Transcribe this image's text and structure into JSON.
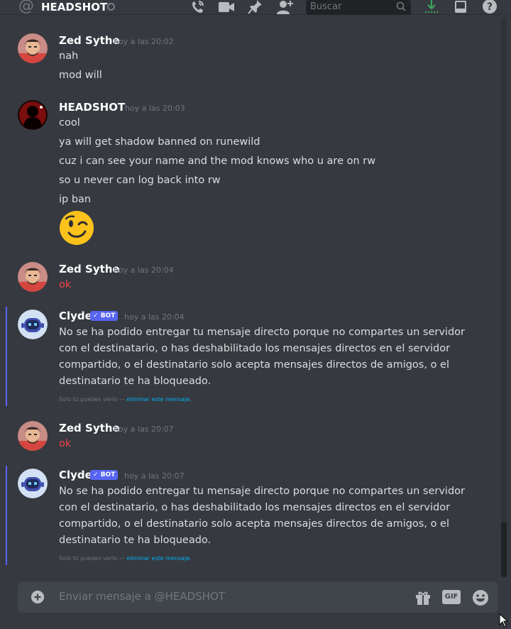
{
  "header": {
    "channel_title": "HEADSHOT",
    "search_placeholder": "Buscar"
  },
  "messages": [
    {
      "author": "Zed Sythe",
      "timestamp": "hoy a las 20:02",
      "lines": [
        "nah",
        "mod will"
      ]
    },
    {
      "author": "HEADSHOT",
      "timestamp": "hoy a las 20:03",
      "lines": [
        "cool",
        "ya will get shadow banned on runewild",
        "cuz i can see your name and the mod knows who u are on rw",
        "so u never can log back into rw",
        "ip ban"
      ],
      "emoji": "winking-face"
    },
    {
      "author": "Zed Sythe",
      "timestamp": "hoy a las 20:04",
      "lines": [
        "ok"
      ]
    },
    {
      "author": "Clyde",
      "badge": "BOT",
      "timestamp": "hoy a las 20:04",
      "body": "No se ha podido entregar tu mensaje directo porque no compartes un servidor con el destinatario, o has deshabilitado los mensajes directos en el servidor compartido, o el destinatario solo acepta mensajes directos de amigos, o el destinatario te ha bloqueado.",
      "ephemeral_text": "Solo tú puedes verlo —",
      "ephemeral_link": "eliminar este mensaje."
    },
    {
      "author": "Zed Sythe",
      "timestamp": "hoy a las 20:07",
      "lines": [
        "ok"
      ]
    },
    {
      "author": "Clyde",
      "badge": "BOT",
      "timestamp": "hoy a las 20:07",
      "body": "No se ha podido entregar tu mensaje directo porque no compartes un servidor con el destinatario, o has deshabilitado los mensajes directos en el servidor compartido, o el destinatario solo acepta mensajes directos de amigos, o el destinatario te ha bloqueado.",
      "ephemeral_text": "Solo tú puedes verlo —",
      "ephemeral_link": "eliminar este mensaje."
    }
  ],
  "composer": {
    "placeholder": "Enviar mensaje a @HEADSHOT",
    "gif_label": "GIF"
  },
  "colors": {
    "background": "#36393f",
    "accent": "#5865f2",
    "error_text": "#f04747",
    "link": "#00aff4"
  }
}
